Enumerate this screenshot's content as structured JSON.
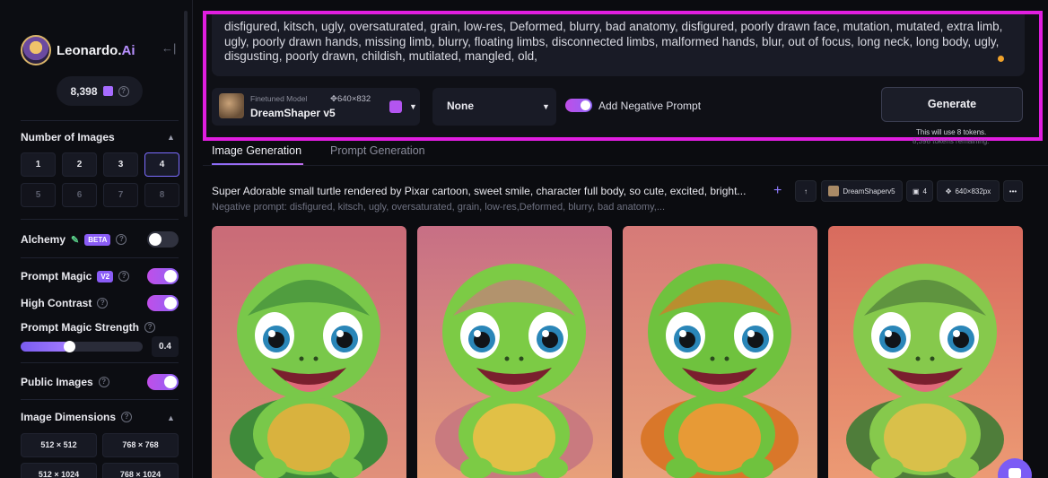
{
  "sidebar": {
    "brand_name": "Leonardo.",
    "brand_suffix": "Ai",
    "token_count": "8,398",
    "number_of_images": {
      "title": "Number of Images",
      "options": [
        "1",
        "2",
        "3",
        "4",
        "5",
        "6",
        "7",
        "8"
      ],
      "selected": "4"
    },
    "alchemy": {
      "label": "Alchemy",
      "badge": "BETA",
      "on": false
    },
    "prompt_magic": {
      "label": "Prompt Magic",
      "badge": "V2",
      "on": true
    },
    "high_contrast": {
      "label": "High Contrast",
      "on": true
    },
    "prompt_magic_strength": {
      "label": "Prompt Magic Strength",
      "value": "0.4",
      "fraction": 0.4
    },
    "public_images": {
      "label": "Public Images",
      "on": true
    },
    "image_dimensions": {
      "title": "Image Dimensions",
      "options": [
        "512 × 512",
        "768 × 768",
        "512 × 1024",
        "768 × 1024"
      ]
    }
  },
  "prompt_panel": {
    "negative_prompt": "disfigured, kitsch, ugly, oversaturated, grain, low-res, Deformed, blurry, bad anatomy, disfigured, poorly drawn face, mutation, mutated, extra limb, ugly, poorly drawn hands, missing limb, blurry, floating limbs, disconnected limbs, malformed hands, blur, out of focus, long neck, long body, ugly, disgusting, poorly drawn, childish, mutilated, mangled, old,",
    "model_caption": "Finetuned Model",
    "model_dims": "640×832",
    "model_name": "DreamShaper v5",
    "style_value": "None",
    "add_negative_label": "Add Negative Prompt",
    "generate_label": "Generate",
    "generate_note": "This will use 8 tokens.",
    "generate_note2": "8,398 tokens remaining."
  },
  "tabs": [
    {
      "label": "Image Generation",
      "active": true
    },
    {
      "label": "Prompt Generation",
      "active": false
    }
  ],
  "generation": {
    "prompt": "Super Adorable small turtle rendered by Pixar cartoon, sweet smile, character full body, so cute, excited, bright...",
    "negative": "Negative prompt: disfigured, kitsch, ugly, oversaturated, grain, low-res,Deformed, blurry, bad anatomy,...",
    "model_chip": "DreamShaperv5",
    "count_chip": "4",
    "dims_chip": "640×832px",
    "images": [
      {
        "bg_top": "#c96b78",
        "bg_bottom": "#e1907a",
        "shell": "#3f8a3a",
        "body": "#79c84a",
        "belly": "#d9b23e"
      },
      {
        "bg_top": "#c76f85",
        "bg_bottom": "#e8a07a",
        "shell": "#c97a7f",
        "body": "#7ccb45",
        "belly": "#e1c046"
      },
      {
        "bg_top": "#d67a78",
        "bg_bottom": "#e8a27c",
        "shell": "#d9772a",
        "body": "#6fc23e",
        "belly": "#e79a36"
      },
      {
        "bg_top": "#d86b5e",
        "bg_bottom": "#ec9a74",
        "shell": "#4f7d3a",
        "body": "#86c94c",
        "belly": "#d9c04a"
      }
    ]
  },
  "colors": {
    "accent": "#8b6cf8",
    "highlight_border": "#e01ee0",
    "background": "#0b0c10"
  }
}
